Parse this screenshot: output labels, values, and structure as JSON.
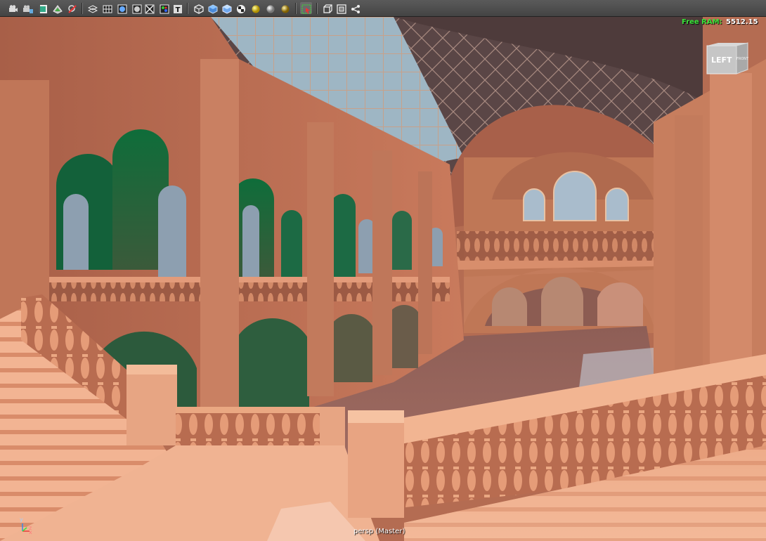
{
  "toolbar": {
    "groups": [
      [
        "camera-icon",
        "camera-attributes-icon",
        "film-gate-icon",
        "image-plane-icon",
        "bookmark-camera-icon"
      ],
      [
        "wireframe-icon",
        "grid-icon",
        "shaded-icon",
        "wireframe-on-shaded-icon",
        "textured-icon",
        "use-lights-icon"
      ],
      [
        "isolate-select-icon",
        "smooth-shade-icon",
        "xray-icon",
        "checker-texture-icon",
        "default-light-icon",
        "shadows-icon",
        "ambient-occlusion-icon"
      ],
      [
        "select-camera-icon"
      ],
      [
        "cube-view-icon",
        "gate-mask-icon",
        "share-icon"
      ]
    ]
  },
  "hud": {
    "free_ram_label": "Free RAM:",
    "free_ram_value": "5512.15",
    "camera_label": "persp (Master)"
  },
  "viewcube": {
    "left_label": "LEFT",
    "front_label": "FRONT"
  },
  "axis": {
    "x": "x",
    "y": "y",
    "z": "z"
  }
}
